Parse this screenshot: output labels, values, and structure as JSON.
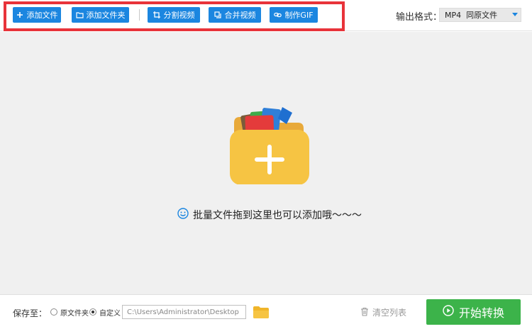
{
  "toolbar": {
    "add_file": "添加文件",
    "add_folder": "添加文件夹",
    "split_video": "分割视频",
    "merge_video": "合并视频",
    "make_gif": "制作GIF",
    "output_format_label": "输出格式：",
    "output_format_value": "MP4  同原文件"
  },
  "main": {
    "drop_hint": "批量文件拖到这里也可以添加哦～～～"
  },
  "bottom": {
    "save_to_label": "保存至：",
    "option_original": "原文件夹",
    "option_custom": "自定义",
    "selected_option": "custom",
    "path_value": "C:\\Users\\Administrator\\Desktop",
    "clear_list": "清空列表",
    "start_convert": "开始转换"
  },
  "colors": {
    "accent_blue": "#1b86e0",
    "start_green": "#3cb34a",
    "highlight_red": "#e8333a",
    "folder_yellow": "#f6c443"
  }
}
